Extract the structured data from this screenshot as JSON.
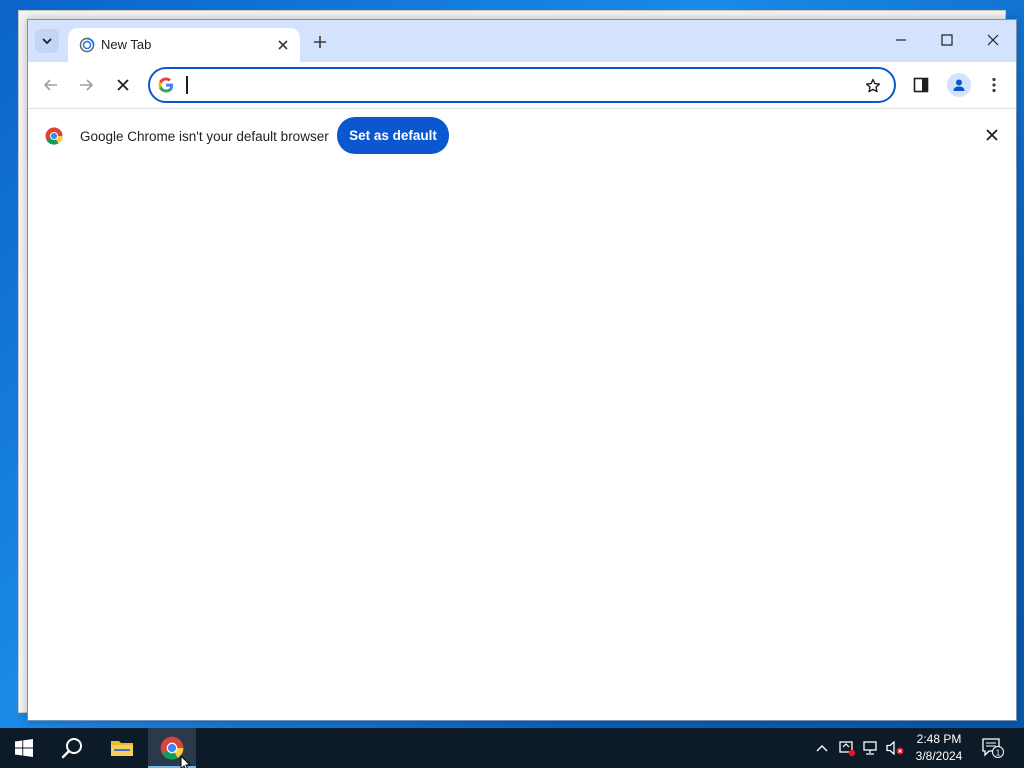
{
  "browser": {
    "tab": {
      "title": "New Tab"
    },
    "omnibox": {
      "value": "",
      "placeholder": ""
    },
    "infobar": {
      "message": "Google Chrome isn't your default browser",
      "button_label": "Set as default"
    }
  },
  "taskbar": {
    "clock_time": "2:48 PM",
    "clock_date": "3/8/2024",
    "notification_count": "1"
  },
  "colors": {
    "titlebar": "#d3e3fd",
    "accent": "#0b57d0",
    "taskbar": "#0d1a28"
  },
  "icons": {
    "tab_search": "chevron-down-icon",
    "tab_favicon": "new-tab-spinner-icon",
    "tab_close": "close-icon",
    "new_tab": "plus-icon",
    "back": "arrow-left-icon",
    "forward": "arrow-right-icon",
    "stop": "close-icon",
    "google": "google-g-icon",
    "bookmark": "star-icon",
    "side_panel": "side-panel-icon",
    "profile": "person-icon",
    "menu": "kebab-menu-icon",
    "start": "windows-logo-icon",
    "search": "search-icon",
    "explorer": "folder-icon",
    "chrome": "chrome-icon"
  }
}
